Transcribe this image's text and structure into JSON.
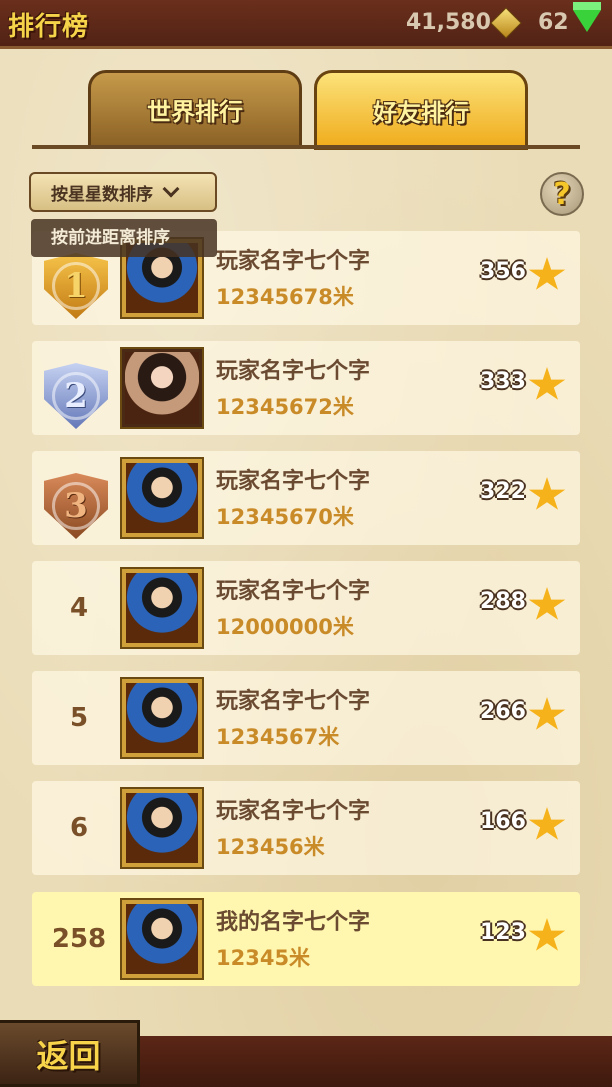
{
  "header": {
    "title": "排行榜",
    "coins": "41,580",
    "gems": "62",
    "coin_icon": "gold-diamond-icon",
    "gem_icon": "green-gem-icon"
  },
  "tabs": [
    {
      "label": "世界排行",
      "active": false
    },
    {
      "label": "好友排行",
      "active": true
    }
  ],
  "sort": {
    "selected": "按星星数排序",
    "option": "按前进距离排序"
  },
  "help_label": "?",
  "rows": [
    {
      "rank": "1",
      "name": "玩家名字七个字",
      "distance": "12345678米",
      "stars": "356"
    },
    {
      "rank": "2",
      "name": "玩家名字七个字",
      "distance": "12345672米",
      "stars": "333"
    },
    {
      "rank": "3",
      "name": "玩家名字七个字",
      "distance": "12345670米",
      "stars": "322"
    },
    {
      "rank": "4",
      "name": "玩家名字七个字",
      "distance": "12000000米",
      "stars": "288"
    },
    {
      "rank": "5",
      "name": "玩家名字七个字",
      "distance": "1234567米",
      "stars": "266"
    },
    {
      "rank": "6",
      "name": "玩家名字七个字",
      "distance": "123456米",
      "stars": "166"
    },
    {
      "rank": "258",
      "name": "我的名字七个字",
      "distance": "12345米",
      "stars": "123"
    }
  ],
  "back_label": "返回",
  "colors": {
    "accent": "#f6d44a",
    "parchment": "#eadcb6",
    "self_row": "#fff7b0"
  }
}
